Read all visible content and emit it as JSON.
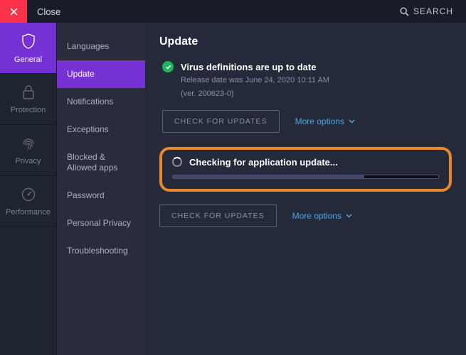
{
  "topbar": {
    "close_label": "Close",
    "search_label": "SEARCH"
  },
  "rail": {
    "items": [
      {
        "label": "General"
      },
      {
        "label": "Protection"
      },
      {
        "label": "Privacy"
      },
      {
        "label": "Performance"
      }
    ]
  },
  "subnav": {
    "items": [
      {
        "label": "Languages"
      },
      {
        "label": "Update"
      },
      {
        "label": "Notifications"
      },
      {
        "label": "Exceptions"
      },
      {
        "label": "Blocked & Allowed apps"
      },
      {
        "label": "Password"
      },
      {
        "label": "Personal Privacy"
      },
      {
        "label": "Troubleshooting"
      }
    ]
  },
  "page": {
    "title": "Update",
    "virus": {
      "title": "Virus definitions are up to date",
      "release": "Release date was June 24, 2020 10:11 AM",
      "version": "(ver. 200623-0)",
      "check_btn": "CHECK FOR UPDATES",
      "more": "More options"
    },
    "app": {
      "checking": "Checking for application update...",
      "check_btn": "CHECK FOR UPDATES",
      "more": "More options"
    }
  }
}
